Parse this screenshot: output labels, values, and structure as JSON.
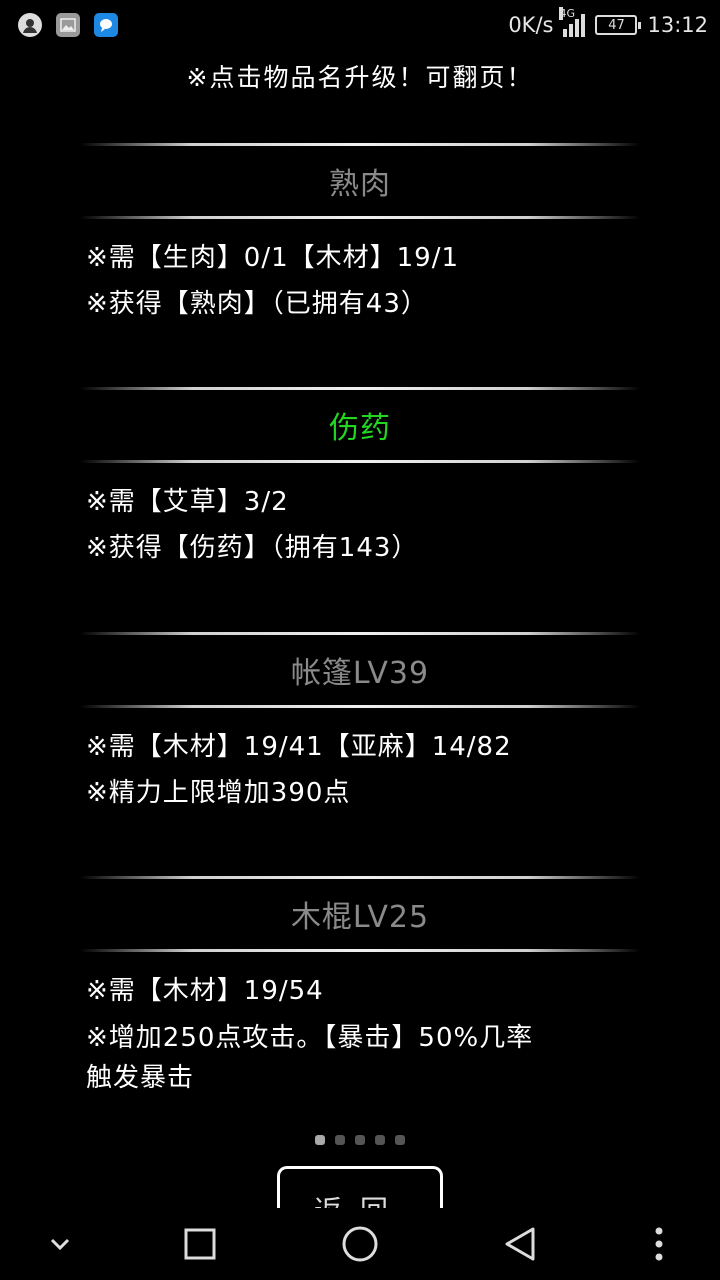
{
  "status_bar": {
    "net_speed": "0K/s",
    "network_type": "4G",
    "battery_level": "47",
    "time": "13:12",
    "left_icons": [
      "avatar-icon",
      "gallery-icon",
      "chat-icon"
    ]
  },
  "header": {
    "text": "※点击物品名升级！可翻页！"
  },
  "items": [
    {
      "name": "熟肉",
      "active": false,
      "lines": [
        "※需【生肉】0/1【木材】19/1",
        "※获得【熟肉】（已拥有43）"
      ]
    },
    {
      "name": "伤药",
      "active": true,
      "lines": [
        "※需【艾草】3/2",
        "※获得【伤药】（拥有143）"
      ]
    },
    {
      "name": "帐篷LV39",
      "active": false,
      "lines": [
        "※需【木材】19/41【亚麻】14/82",
        "※精力上限增加390点"
      ]
    },
    {
      "name": "木棍LV25",
      "active": false,
      "lines": [
        "※需【木材】19/54",
        "※增加250点攻击。【暴击】50%几率",
        "触发暴击"
      ]
    }
  ],
  "pager": {
    "total_pages": 5,
    "current_page": 1
  },
  "back_button": {
    "label": "返回"
  },
  "colors": {
    "background": "#000000",
    "active_item": "#22d622",
    "inactive_item": "#8a8a8a",
    "text": "#ffffff"
  },
  "nav_bar": {
    "icons": [
      "chevron-down-icon",
      "recents-square-icon",
      "home-circle-icon",
      "back-triangle-icon",
      "more-dots-icon"
    ]
  }
}
